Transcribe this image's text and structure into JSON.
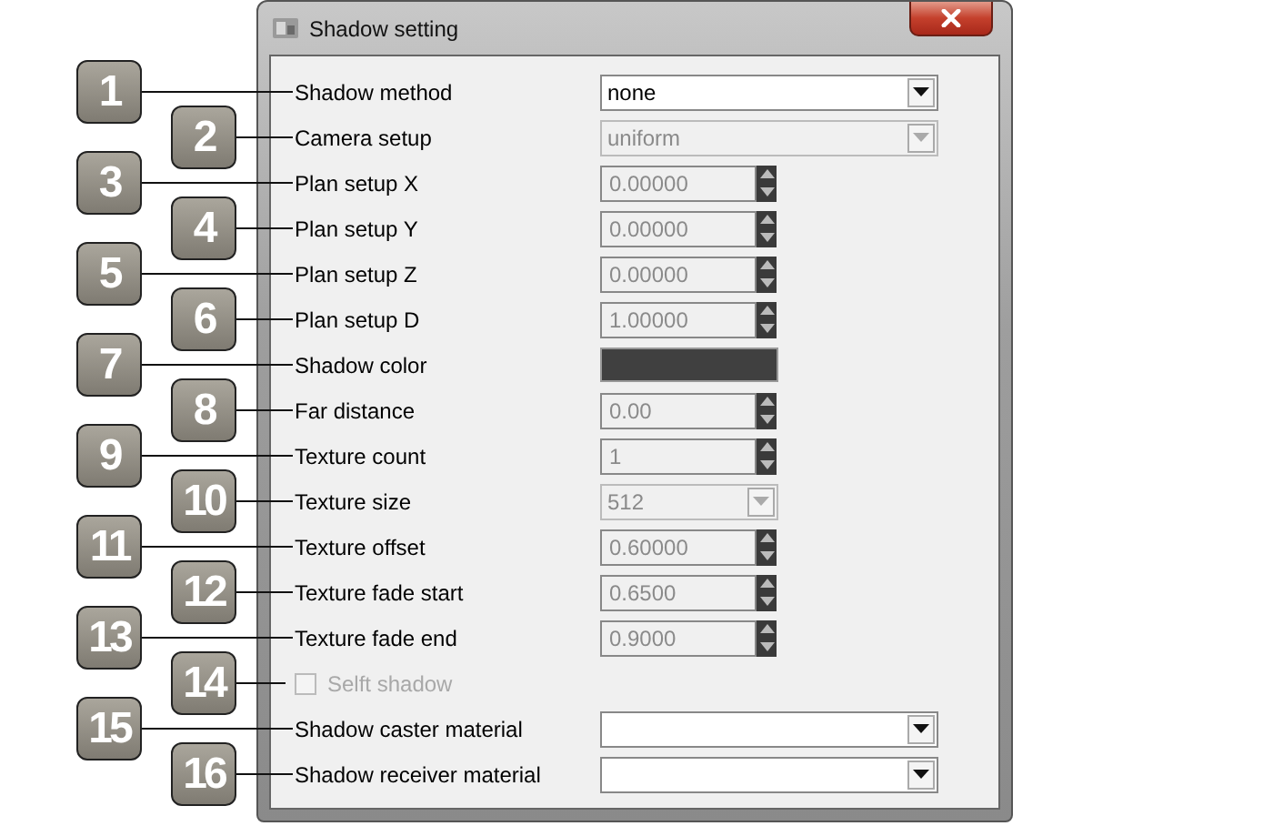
{
  "window": {
    "title": "Shadow setting"
  },
  "rows": [
    {
      "callout": "1",
      "kind": "combo",
      "label": "Shadow method",
      "value": "none",
      "disabled": false
    },
    {
      "callout": "2",
      "kind": "combo",
      "label": "Camera setup",
      "value": "uniform",
      "disabled": true
    },
    {
      "callout": "3",
      "kind": "spin",
      "label": "Plan setup X",
      "value": "0.00000",
      "disabled": true
    },
    {
      "callout": "4",
      "kind": "spin",
      "label": "Plan setup Y",
      "value": "0.00000",
      "disabled": true
    },
    {
      "callout": "5",
      "kind": "spin",
      "label": "Plan setup Z",
      "value": "0.00000",
      "disabled": true
    },
    {
      "callout": "6",
      "kind": "spin",
      "label": "Plan setup D",
      "value": "1.00000",
      "disabled": true
    },
    {
      "callout": "7",
      "kind": "color",
      "label": "Shadow color",
      "color": "#404040"
    },
    {
      "callout": "8",
      "kind": "spin",
      "label": "Far distance",
      "value": "0.00",
      "disabled": true
    },
    {
      "callout": "9",
      "kind": "spin",
      "label": "Texture count",
      "value": "1",
      "disabled": true
    },
    {
      "callout": "10",
      "kind": "smallcombo",
      "label": "Texture size",
      "value": "512",
      "disabled": true
    },
    {
      "callout": "11",
      "kind": "spin",
      "label": "Texture offset",
      "value": "0.60000",
      "disabled": true
    },
    {
      "callout": "12",
      "kind": "spin",
      "label": "Texture fade start",
      "value": "0.6500",
      "disabled": true
    },
    {
      "callout": "13",
      "kind": "spin",
      "label": "Texture fade end",
      "value": "0.9000",
      "disabled": true
    },
    {
      "callout": "14",
      "kind": "checkbox",
      "label": "Selft shadow",
      "checked": false,
      "disabled": true
    },
    {
      "callout": "15",
      "kind": "combo",
      "label": "Shadow caster material",
      "disabled": false
    },
    {
      "callout": "16",
      "kind": "combo",
      "label": "Shadow receiver material",
      "disabled": false
    }
  ]
}
